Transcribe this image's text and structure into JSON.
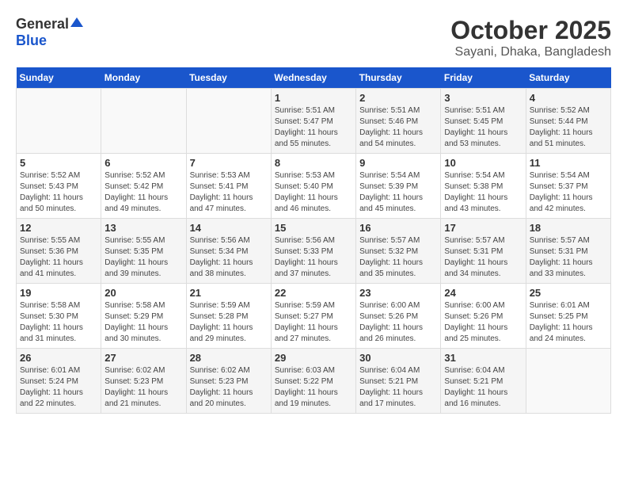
{
  "logo": {
    "general": "General",
    "blue": "Blue"
  },
  "title": "October 2025",
  "subtitle": "Sayani, Dhaka, Bangladesh",
  "days_of_week": [
    "Sunday",
    "Monday",
    "Tuesday",
    "Wednesday",
    "Thursday",
    "Friday",
    "Saturday"
  ],
  "weeks": [
    [
      {
        "day": "",
        "content": ""
      },
      {
        "day": "",
        "content": ""
      },
      {
        "day": "",
        "content": ""
      },
      {
        "day": "1",
        "content": "Sunrise: 5:51 AM\nSunset: 5:47 PM\nDaylight: 11 hours and 55 minutes."
      },
      {
        "day": "2",
        "content": "Sunrise: 5:51 AM\nSunset: 5:46 PM\nDaylight: 11 hours and 54 minutes."
      },
      {
        "day": "3",
        "content": "Sunrise: 5:51 AM\nSunset: 5:45 PM\nDaylight: 11 hours and 53 minutes."
      },
      {
        "day": "4",
        "content": "Sunrise: 5:52 AM\nSunset: 5:44 PM\nDaylight: 11 hours and 51 minutes."
      }
    ],
    [
      {
        "day": "5",
        "content": "Sunrise: 5:52 AM\nSunset: 5:43 PM\nDaylight: 11 hours and 50 minutes."
      },
      {
        "day": "6",
        "content": "Sunrise: 5:52 AM\nSunset: 5:42 PM\nDaylight: 11 hours and 49 minutes."
      },
      {
        "day": "7",
        "content": "Sunrise: 5:53 AM\nSunset: 5:41 PM\nDaylight: 11 hours and 47 minutes."
      },
      {
        "day": "8",
        "content": "Sunrise: 5:53 AM\nSunset: 5:40 PM\nDaylight: 11 hours and 46 minutes."
      },
      {
        "day": "9",
        "content": "Sunrise: 5:54 AM\nSunset: 5:39 PM\nDaylight: 11 hours and 45 minutes."
      },
      {
        "day": "10",
        "content": "Sunrise: 5:54 AM\nSunset: 5:38 PM\nDaylight: 11 hours and 43 minutes."
      },
      {
        "day": "11",
        "content": "Sunrise: 5:54 AM\nSunset: 5:37 PM\nDaylight: 11 hours and 42 minutes."
      }
    ],
    [
      {
        "day": "12",
        "content": "Sunrise: 5:55 AM\nSunset: 5:36 PM\nDaylight: 11 hours and 41 minutes."
      },
      {
        "day": "13",
        "content": "Sunrise: 5:55 AM\nSunset: 5:35 PM\nDaylight: 11 hours and 39 minutes."
      },
      {
        "day": "14",
        "content": "Sunrise: 5:56 AM\nSunset: 5:34 PM\nDaylight: 11 hours and 38 minutes."
      },
      {
        "day": "15",
        "content": "Sunrise: 5:56 AM\nSunset: 5:33 PM\nDaylight: 11 hours and 37 minutes."
      },
      {
        "day": "16",
        "content": "Sunrise: 5:57 AM\nSunset: 5:32 PM\nDaylight: 11 hours and 35 minutes."
      },
      {
        "day": "17",
        "content": "Sunrise: 5:57 AM\nSunset: 5:31 PM\nDaylight: 11 hours and 34 minutes."
      },
      {
        "day": "18",
        "content": "Sunrise: 5:57 AM\nSunset: 5:31 PM\nDaylight: 11 hours and 33 minutes."
      }
    ],
    [
      {
        "day": "19",
        "content": "Sunrise: 5:58 AM\nSunset: 5:30 PM\nDaylight: 11 hours and 31 minutes."
      },
      {
        "day": "20",
        "content": "Sunrise: 5:58 AM\nSunset: 5:29 PM\nDaylight: 11 hours and 30 minutes."
      },
      {
        "day": "21",
        "content": "Sunrise: 5:59 AM\nSunset: 5:28 PM\nDaylight: 11 hours and 29 minutes."
      },
      {
        "day": "22",
        "content": "Sunrise: 5:59 AM\nSunset: 5:27 PM\nDaylight: 11 hours and 27 minutes."
      },
      {
        "day": "23",
        "content": "Sunrise: 6:00 AM\nSunset: 5:26 PM\nDaylight: 11 hours and 26 minutes."
      },
      {
        "day": "24",
        "content": "Sunrise: 6:00 AM\nSunset: 5:26 PM\nDaylight: 11 hours and 25 minutes."
      },
      {
        "day": "25",
        "content": "Sunrise: 6:01 AM\nSunset: 5:25 PM\nDaylight: 11 hours and 24 minutes."
      }
    ],
    [
      {
        "day": "26",
        "content": "Sunrise: 6:01 AM\nSunset: 5:24 PM\nDaylight: 11 hours and 22 minutes."
      },
      {
        "day": "27",
        "content": "Sunrise: 6:02 AM\nSunset: 5:23 PM\nDaylight: 11 hours and 21 minutes."
      },
      {
        "day": "28",
        "content": "Sunrise: 6:02 AM\nSunset: 5:23 PM\nDaylight: 11 hours and 20 minutes."
      },
      {
        "day": "29",
        "content": "Sunrise: 6:03 AM\nSunset: 5:22 PM\nDaylight: 11 hours and 19 minutes."
      },
      {
        "day": "30",
        "content": "Sunrise: 6:04 AM\nSunset: 5:21 PM\nDaylight: 11 hours and 17 minutes."
      },
      {
        "day": "31",
        "content": "Sunrise: 6:04 AM\nSunset: 5:21 PM\nDaylight: 11 hours and 16 minutes."
      },
      {
        "day": "",
        "content": ""
      }
    ]
  ]
}
